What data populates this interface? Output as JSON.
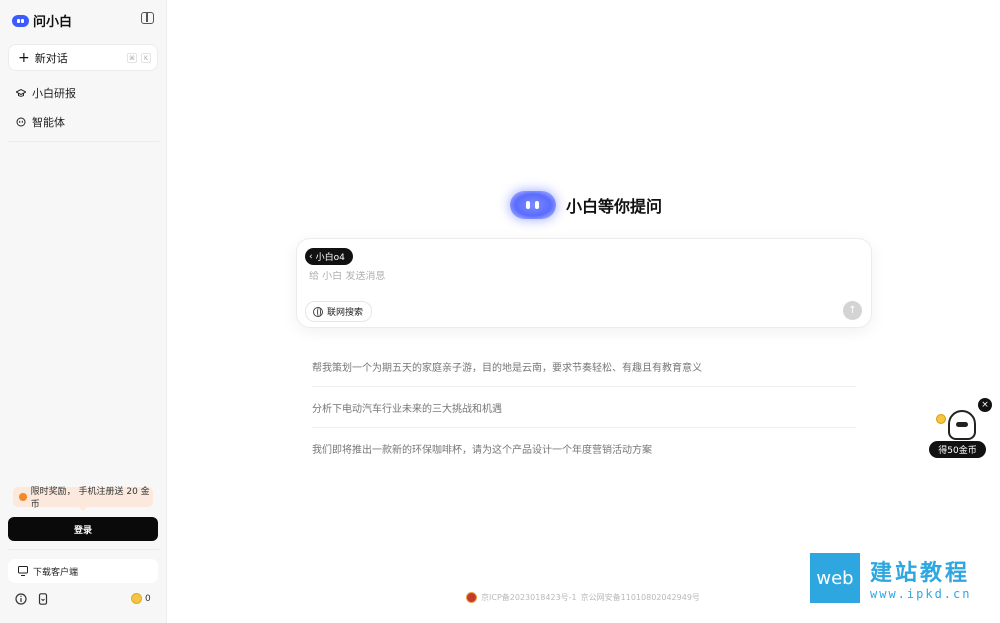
{
  "app": {
    "name": "问小白",
    "brand_color": "#3b5bff"
  },
  "sidebar": {
    "new_chat": {
      "label": "新对话",
      "shortcut_keys": [
        "⌘",
        "K"
      ]
    },
    "items": [
      {
        "label": "小白研报",
        "icon": "graduation-cap-icon"
      },
      {
        "label": "智能体",
        "icon": "bot-icon"
      }
    ],
    "promo": {
      "text": "限时奖励， 手机注册送 20 金币"
    },
    "login_label": "登录",
    "download_label": "下载客户端",
    "coins": "0"
  },
  "main": {
    "hero_title": "小白等你提问",
    "composer": {
      "model_label": "小白o4",
      "placeholder": "给 小白 发送消息",
      "web_search_label": "联网搜索"
    },
    "suggestions": [
      "帮我策划一个为期五天的家庭亲子游，目的地是云南，要求节奏轻松、有趣且有教育意义",
      "分析下电动汽车行业未来的三大挑战和机遇",
      "我们即将推出一款新的环保咖啡杯，请为这个产品设计一个年度营销活动方案"
    ],
    "footer": {
      "icp": "京ICP备2023018423号-1",
      "police": "京公网安备11010802042949号"
    }
  },
  "reward_widget": {
    "label": "得50金币",
    "close_glyph": "×"
  },
  "watermark": {
    "box_text": "web",
    "title": "建站教程",
    "url": "www.ipkd.cn"
  }
}
